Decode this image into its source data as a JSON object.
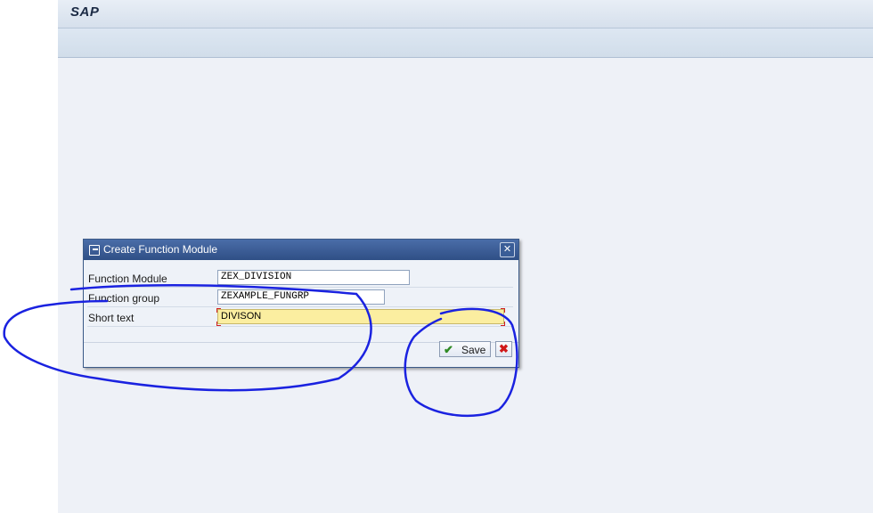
{
  "app": {
    "brand": "SAP"
  },
  "dialog": {
    "title": "Create Function Module",
    "title_icon": "create-document-icon",
    "close_icon": "close-icon",
    "close_label": "✕",
    "fields": [
      {
        "label": "Function Module",
        "value": "ZEX_DIVISION"
      },
      {
        "label": "Function group",
        "value": "ZEXAMPLE_FUNGRP"
      },
      {
        "label": "Short text",
        "value": "DIVISON",
        "required": true
      }
    ],
    "buttons": {
      "save_label": "Save",
      "save_icon": "checkmark-icon",
      "cancel_icon": "cancel-icon"
    }
  },
  "colors": {
    "annotation": "#1a22e0",
    "dialog_header": "#2f4f86",
    "required_field": "#fbeea0"
  }
}
